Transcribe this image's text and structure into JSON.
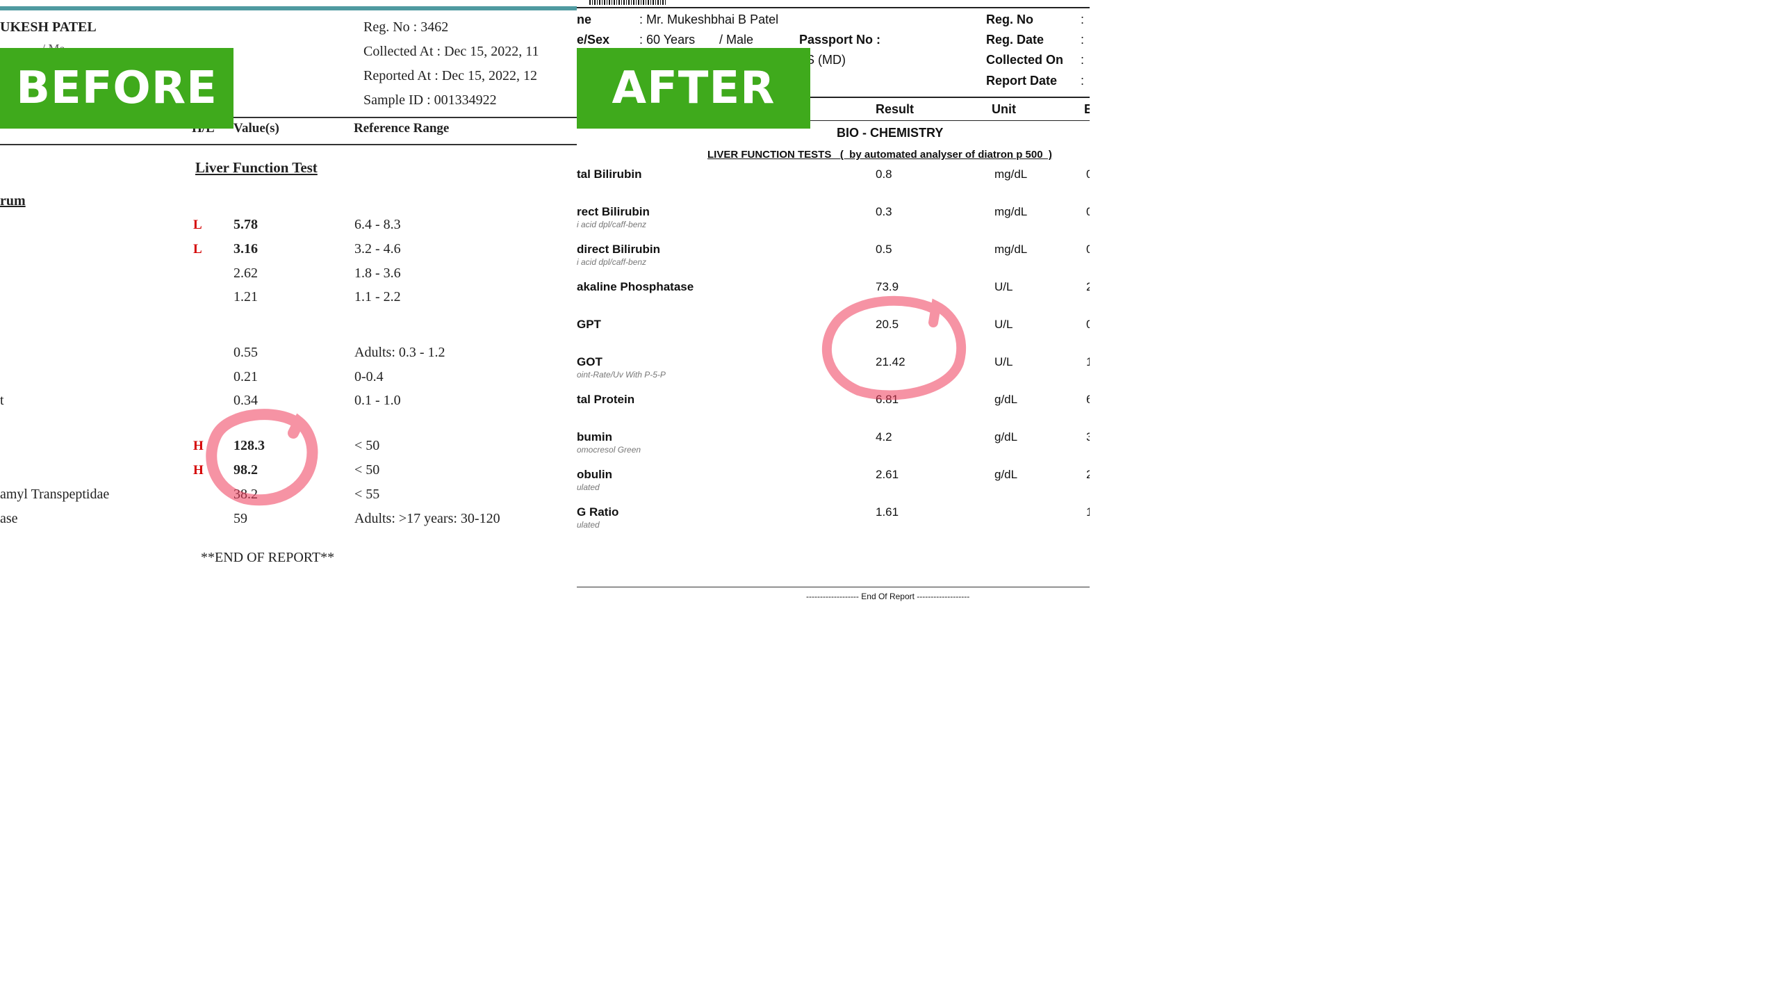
{
  "before": {
    "badge": "BEFORE",
    "patient_name": "UKESH PATEL",
    "patient_sub": "/ Ma",
    "meta": [
      "Reg. No : 3462",
      "Collected At : Dec 15, 2022, 11",
      "Reported At : Dec 15, 2022, 12",
      "Sample ID : 001334922"
    ],
    "columns": {
      "hl": "H/L",
      "value": "Value(s)",
      "range": "Reference Range"
    },
    "section_title": "Liver Function Test",
    "group_label": "rum",
    "rows": [
      {
        "name": "",
        "flag": "L",
        "value": "5.78",
        "range": "6.4 - 8.3",
        "bold": true
      },
      {
        "name": "",
        "flag": "L",
        "value": "3.16",
        "range": "3.2 - 4.6",
        "bold": true
      },
      {
        "name": "",
        "flag": "",
        "value": "2.62",
        "range": "1.8 - 3.6",
        "bold": false
      },
      {
        "name": "",
        "flag": "",
        "value": "1.21",
        "range": "1.1 - 2.2",
        "bold": false
      },
      {
        "name": "",
        "flag": "",
        "value": "0.55",
        "range": "Adults: 0.3 - 1.2",
        "bold": false
      },
      {
        "name": "",
        "flag": "",
        "value": "0.21",
        "range": "0-0.4",
        "bold": false
      },
      {
        "name": "t",
        "flag": "",
        "value": "0.34",
        "range": "0.1 - 1.0",
        "bold": false
      },
      {
        "name": "",
        "flag": "H",
        "value": "128.3",
        "range": "< 50",
        "bold": true
      },
      {
        "name": "",
        "flag": "H",
        "value": "98.2",
        "range": "< 50",
        "bold": true
      },
      {
        "name": "amyl Transpeptidae",
        "flag": "",
        "value": "38.2",
        "range": "< 55",
        "bold": false
      },
      {
        "name": "ase",
        "flag": "",
        "value": "59",
        "range": "Adults: >17 years: 30-120",
        "bold": false
      }
    ],
    "end": "**END OF REPORT**"
  },
  "after": {
    "badge": "AFTER",
    "header": {
      "name_label": "ne",
      "name_value": ": Mr. Mukeshbhai B Patel",
      "agesex_label": "e/Sex",
      "age_value": ": 60 Years",
      "sex_value": "/ Male",
      "passport_label": "Passport No :",
      "doctor_value": "S (MD)",
      "reg_no": "Reg. No",
      "reg_date": "Reg. Date",
      "collected_on": "Collected On",
      "report_date": "Report Date",
      "colon": ":"
    },
    "columns": {
      "result": "Result",
      "unit": "Unit",
      "extra": "E"
    },
    "section_title": "BIO - CHEMISTRY",
    "subsection_title": "LIVER FUNCTION TESTS   (  by automated analyser of diatron p 500  )",
    "rows": [
      {
        "name": "tal Bilirubin",
        "method": "",
        "result": "0.8",
        "unit": "mg/dL",
        "extra": "0"
      },
      {
        "name": "rect Bilirubin",
        "method": "i acid dpl/caff-benz",
        "result": "0.3",
        "unit": "mg/dL",
        "extra": "0"
      },
      {
        "name": "direct Bilirubin",
        "method": "i acid dpl/caff-benz",
        "result": "0.5",
        "unit": "mg/dL",
        "extra": "0"
      },
      {
        "name": "akaline Phosphatase",
        "method": "",
        "result": "73.9",
        "unit": "U/L",
        "extra": "2"
      },
      {
        "name": "GPT",
        "method": "",
        "result": "20.5",
        "unit": "U/L",
        "extra": "0"
      },
      {
        "name": "GOT",
        "method": "oint-Rate/Uv With P-5-P",
        "result": "21.42",
        "unit": "U/L",
        "extra": "1"
      },
      {
        "name": "tal Protein",
        "method": "",
        "result": "6.81",
        "unit": "g/dL",
        "extra": "6"
      },
      {
        "name": "bumin",
        "method": "omocresol Green",
        "result": "4.2",
        "unit": "g/dL",
        "extra": "3"
      },
      {
        "name": "obulin",
        "method": "ulated",
        "result": "2.61",
        "unit": "g/dL",
        "extra": "2"
      },
      {
        "name": "G Ratio",
        "method": "ulated",
        "result": "1.61",
        "unit": "",
        "extra": "1"
      }
    ],
    "end": "------------------- End Of Report -------------------"
  }
}
